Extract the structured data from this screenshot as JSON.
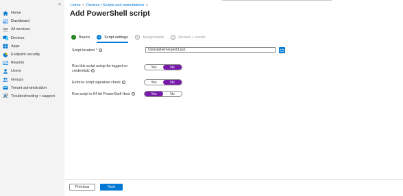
{
  "sidebar": {
    "collapse_glyph": "«",
    "items": [
      {
        "label": "Home",
        "icon": "home-icon"
      },
      {
        "label": "Dashboard",
        "icon": "dashboard-icon"
      },
      {
        "label": "All services",
        "icon": "all-services-icon"
      },
      {
        "label": "Devices",
        "icon": "devices-icon"
      },
      {
        "label": "Apps",
        "icon": "apps-icon"
      },
      {
        "label": "Endpoint security",
        "icon": "endpoint-security-icon"
      },
      {
        "label": "Reports",
        "icon": "reports-icon"
      },
      {
        "label": "Users",
        "icon": "users-icon"
      },
      {
        "label": "Groups",
        "icon": "groups-icon"
      },
      {
        "label": "Tenant administration",
        "icon": "tenant-admin-icon"
      },
      {
        "label": "Troubleshooting + support",
        "icon": "troubleshooting-icon"
      }
    ]
  },
  "breadcrumb": {
    "home": "Home",
    "devices": "Devices | Scripts and remediations",
    "sep": ">"
  },
  "page": {
    "title": "Add PowerShell script",
    "more": "···"
  },
  "steps": [
    {
      "label": "Basics",
      "state": "done",
      "marker": "✓"
    },
    {
      "label": "Script settings",
      "state": "active",
      "marker": "2"
    },
    {
      "label": "Assignments",
      "state": "pending",
      "marker": "3"
    },
    {
      "label": "Review + create",
      "state": "pending",
      "marker": "4"
    }
  ],
  "form": {
    "script_location_label": "Script location *",
    "script_location_value": "Uninstall-Emergent3.ps1",
    "run_logged_on_label": "Run this script using the logged on credentials",
    "run_logged_on_value": "No",
    "signature_label": "Enforce script signature check",
    "signature_value": "No",
    "run64_label": "Run script in 64 bit PowerShell Host",
    "run64_value": "Yes",
    "yes": "Yes",
    "no": "No",
    "info_glyph": "i"
  },
  "footer": {
    "previous": "Previous",
    "next": "Next"
  },
  "colors": {
    "accent": "#0078d4",
    "toggle_selected": "#7719aa",
    "done": "#107c10"
  }
}
